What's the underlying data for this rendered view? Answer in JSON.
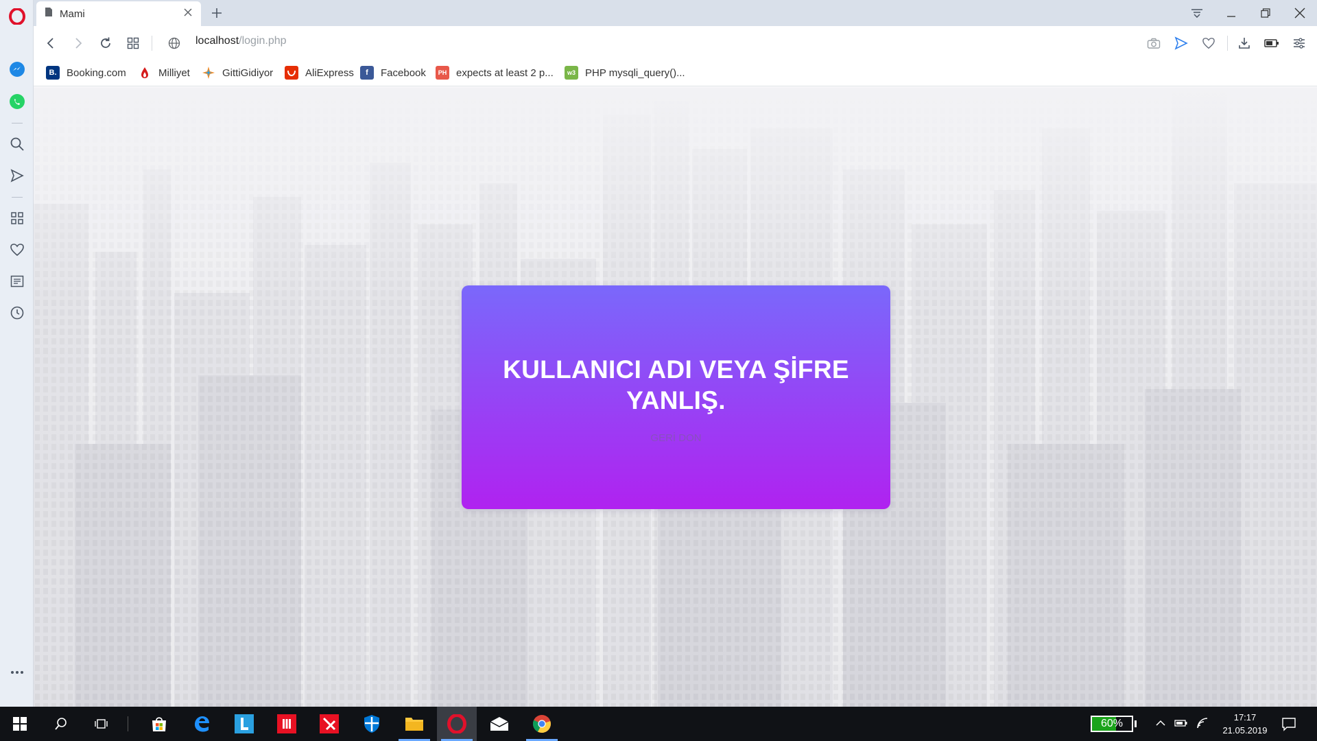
{
  "browser": {
    "tab": {
      "title": "Mami"
    },
    "address": {
      "host": "localhost",
      "path": "/login.php"
    }
  },
  "bookmarks": [
    {
      "label": "Booking.com",
      "icon": "booking-icon",
      "color": "#003580"
    },
    {
      "label": "Milliyet",
      "icon": "milliyet-icon",
      "color": "#d51c1c"
    },
    {
      "label": "GittiGidiyor",
      "icon": "gittigidiyor-icon",
      "color": "#f28c28"
    },
    {
      "label": "AliExpress",
      "icon": "aliexpress-icon",
      "color": "#e62e04"
    },
    {
      "label": "Facebook",
      "icon": "facebook-icon",
      "color": "#3b5998"
    },
    {
      "label": "expects at least 2 p...",
      "icon": "php-doc-icon",
      "color": "#e8584a"
    },
    {
      "label": "PHP mysqli_query()...",
      "icon": "w3schools-icon",
      "color": "#7ab648"
    }
  ],
  "page": {
    "message_line1": "KULLANICI ADI VEYA ŞİFRE",
    "message_line2": "YANLIŞ.",
    "back_link": "GERİ DON",
    "card_gradient": [
      "#7a68fb",
      "#b022f0"
    ]
  },
  "taskbar": {
    "battery_percent": "60%",
    "battery_level": 0.6,
    "time": "17:17",
    "date": "21.05.2019"
  }
}
